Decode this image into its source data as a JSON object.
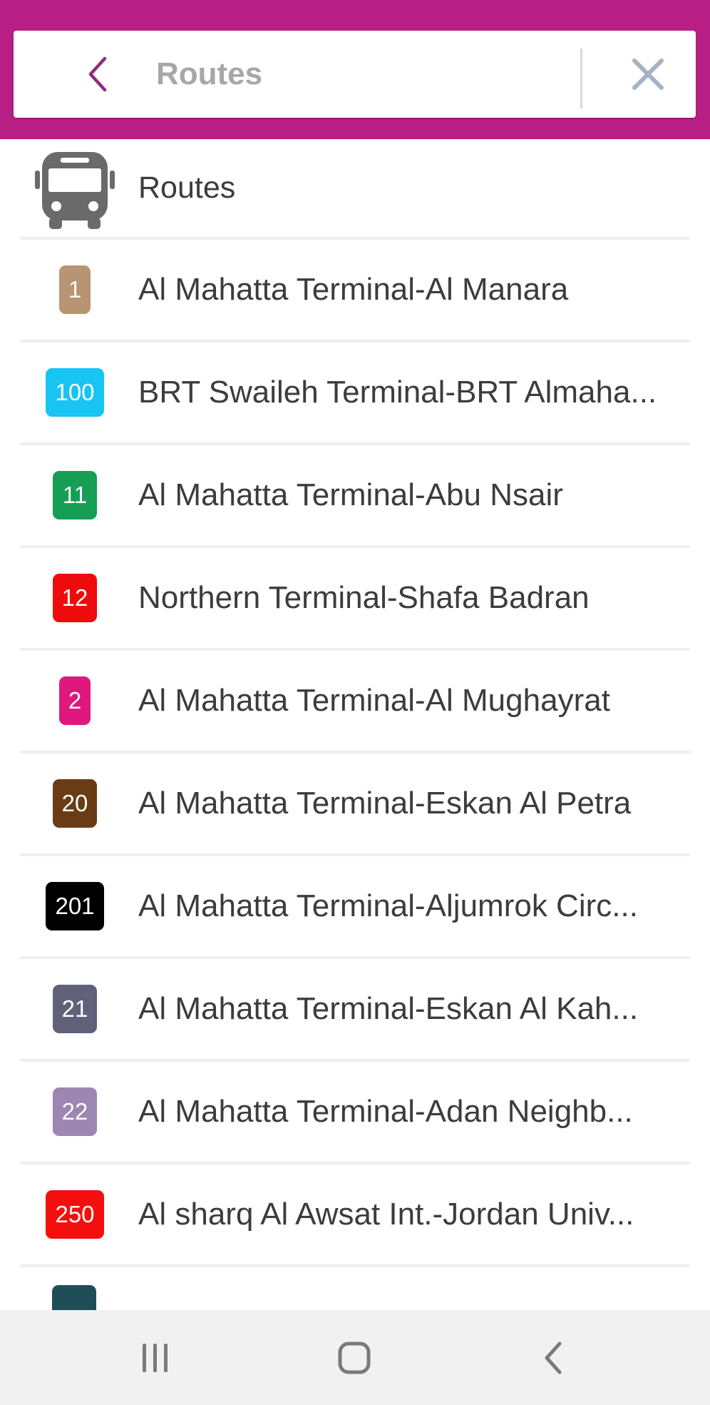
{
  "search": {
    "value": "Routes",
    "back_icon": "chevron-left-icon",
    "clear_icon": "close-icon"
  },
  "colors": {
    "app_bar": "#b81f85",
    "back_icon": "#8f2c7a",
    "clear_icon": "#a4b3c4",
    "text": "#3c3c3c"
  },
  "section": {
    "icon": "bus-icon",
    "label": "Routes"
  },
  "routes": [
    {
      "number": "1",
      "color": "#b89472",
      "name": "Al Mahatta Terminal-Al Manara"
    },
    {
      "number": "100",
      "color": "#17c4f2",
      "name": "BRT Swaileh Terminal-BRT Almaha..."
    },
    {
      "number": "11",
      "color": "#169e55",
      "name": "Al Mahatta Terminal-Abu Nsair"
    },
    {
      "number": "12",
      "color": "#ee0b0b",
      "name": "Northern Terminal-Shafa Badran"
    },
    {
      "number": "2",
      "color": "#e0187e",
      "name": "Al Mahatta Terminal-Al Mughayrat"
    },
    {
      "number": "20",
      "color": "#6a3c15",
      "name": "Al Mahatta Terminal-Eskan Al Petra"
    },
    {
      "number": "201",
      "color": "#000000",
      "name": "Al Mahatta Terminal-Aljumrok Circ..."
    },
    {
      "number": "21",
      "color": "#606079",
      "name": "Al Mahatta Terminal-Eskan Al Kah..."
    },
    {
      "number": "22",
      "color": "#9d86b2",
      "name": "Al Mahatta Terminal-Adan Neighb..."
    },
    {
      "number": "250",
      "color": "#f50e0e",
      "name": "Al sharq Al Awsat Int.-Jordan Univ..."
    }
  ],
  "nav": {
    "recents_icon": "recent-apps-icon",
    "home_icon": "home-icon",
    "back_icon": "back-icon"
  }
}
